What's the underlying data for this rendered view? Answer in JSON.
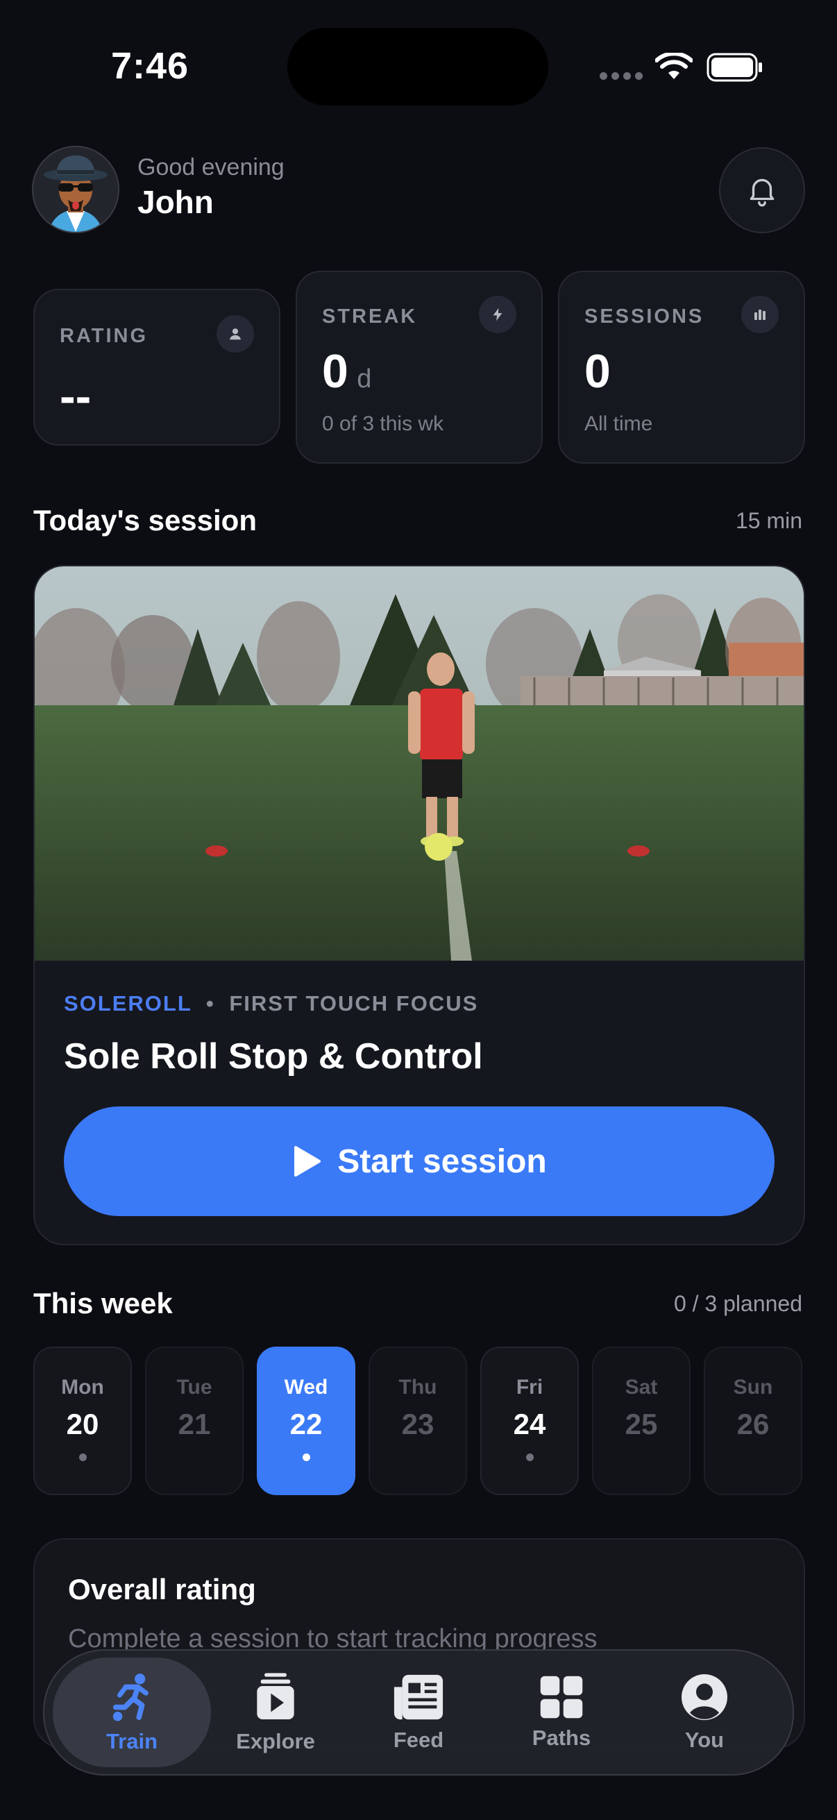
{
  "status_bar": {
    "time": "7:46"
  },
  "header": {
    "greeting": "Good evening",
    "name": "John"
  },
  "stats": [
    {
      "label": "RATING",
      "value": "--",
      "unit": "",
      "sub": "",
      "icon": "person-icon"
    },
    {
      "label": "STREAK",
      "value": "0",
      "unit": "d",
      "sub": "0 of 3 this wk",
      "icon": "bolt-icon"
    },
    {
      "label": "SESSIONS",
      "value": "0",
      "unit": "",
      "sub": "All time",
      "icon": "bar-chart-icon"
    }
  ],
  "today": {
    "title": "Today's session",
    "duration": "15 min",
    "category": "SOLEROLL",
    "separator": "•",
    "focus": "FIRST TOUCH FOCUS",
    "session_title": "Sole Roll Stop & Control",
    "start_label": "Start session"
  },
  "week": {
    "title": "This week",
    "planned": "0 / 3 planned",
    "days": [
      {
        "name": "Mon",
        "date": "20"
      },
      {
        "name": "Tue",
        "date": "21"
      },
      {
        "name": "Wed",
        "date": "22"
      },
      {
        "name": "Thu",
        "date": "23"
      },
      {
        "name": "Fri",
        "date": "24"
      },
      {
        "name": "Sat",
        "date": "25"
      },
      {
        "name": "Sun",
        "date": "26"
      }
    ]
  },
  "overall": {
    "title": "Overall rating",
    "subtitle": "Complete a session to start tracking progress"
  },
  "tabs": [
    {
      "label": "Train",
      "icon": "running-player-icon"
    },
    {
      "label": "Explore",
      "icon": "play-stack-icon"
    },
    {
      "label": "Feed",
      "icon": "newspaper-icon"
    },
    {
      "label": "Paths",
      "icon": "grid-icon"
    },
    {
      "label": "You",
      "icon": "profile-icon"
    }
  ],
  "colors": {
    "accent": "#3b7af7",
    "background": "#0c0d12",
    "card": "#16181f"
  }
}
